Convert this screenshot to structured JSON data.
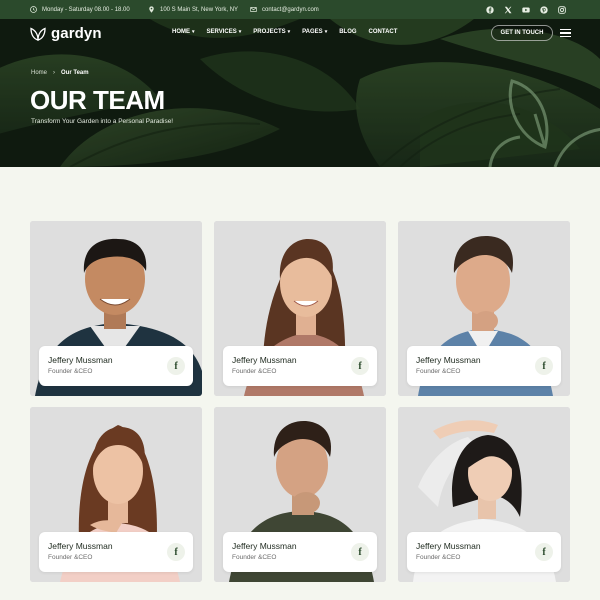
{
  "topbar": {
    "hours": "Monday - Saturday 08.00 - 18.00",
    "address": "100 S Main St, New York, NY",
    "email": "contact@gardyn.com",
    "socials": [
      "facebook-icon",
      "x-icon",
      "youtube-icon",
      "pinterest-icon",
      "instagram-icon"
    ]
  },
  "header": {
    "logo_text": "gardyn",
    "menu": [
      {
        "label": "HOME",
        "dropdown": true
      },
      {
        "label": "SERVICES",
        "dropdown": true
      },
      {
        "label": "PROJECTS",
        "dropdown": true
      },
      {
        "label": "PAGES",
        "dropdown": true
      },
      {
        "label": "BLOG",
        "dropdown": false
      },
      {
        "label": "CONTACT",
        "dropdown": false
      }
    ],
    "cta_label": "GET IN TOUCH"
  },
  "hero": {
    "breadcrumb": {
      "home": "Home",
      "current": "Our Team"
    },
    "title": "OUR TEAM",
    "subtitle": "Transform Your Garden into a Personal Paradise!"
  },
  "team": [
    {
      "name": "Jeffery Mussman",
      "role": "Founder &CEO",
      "social": "f"
    },
    {
      "name": "Jeffery Mussman",
      "role": "Founder &CEO",
      "social": "f"
    },
    {
      "name": "Jeffery Mussman",
      "role": "Founder &CEO",
      "social": "f"
    },
    {
      "name": "Jeffery Mussman",
      "role": "Founder &CEO",
      "social": "f"
    },
    {
      "name": "Jeffery Mussman",
      "role": "Founder &CEO",
      "social": "f"
    },
    {
      "name": "Jeffery Mussman",
      "role": "Founder &CEO",
      "social": "f"
    }
  ],
  "colors": {
    "brand_dark_green": "#2b4a2c",
    "page_bg": "#f4f6ef",
    "card_bg": "#dcdcdc"
  }
}
